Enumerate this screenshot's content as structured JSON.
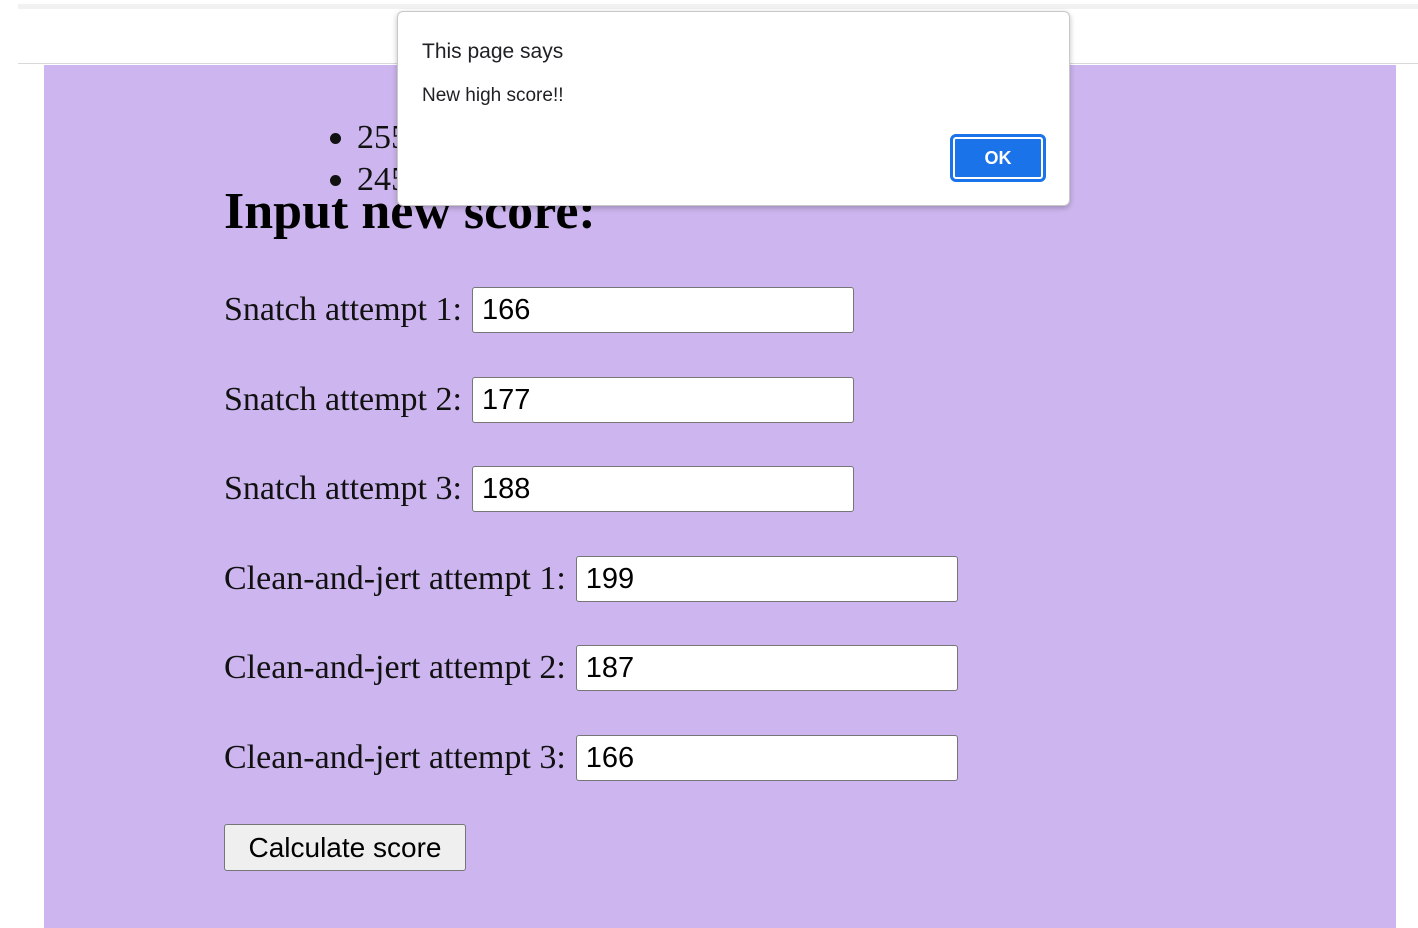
{
  "dialog": {
    "title": "This page says",
    "message": "New high score!!",
    "ok_label": "OK"
  },
  "scores_list": [
    "255",
    "245"
  ],
  "form": {
    "heading": "Input new score:",
    "fields": [
      {
        "label": "Snatch attempt 1:",
        "value": "166"
      },
      {
        "label": "Snatch attempt 2:",
        "value": "177"
      },
      {
        "label": "Snatch attempt 3:",
        "value": "188"
      },
      {
        "label": "Clean-and-jert attempt 1:",
        "value": "199"
      },
      {
        "label": "Clean-and-jert attempt 2:",
        "value": "187"
      },
      {
        "label": "Clean-and-jert attempt 3:",
        "value": "166"
      }
    ],
    "submit_label": "Calculate score"
  },
  "colors": {
    "page_background": "#cdb6ef",
    "dialog_button": "#1a73e8"
  }
}
